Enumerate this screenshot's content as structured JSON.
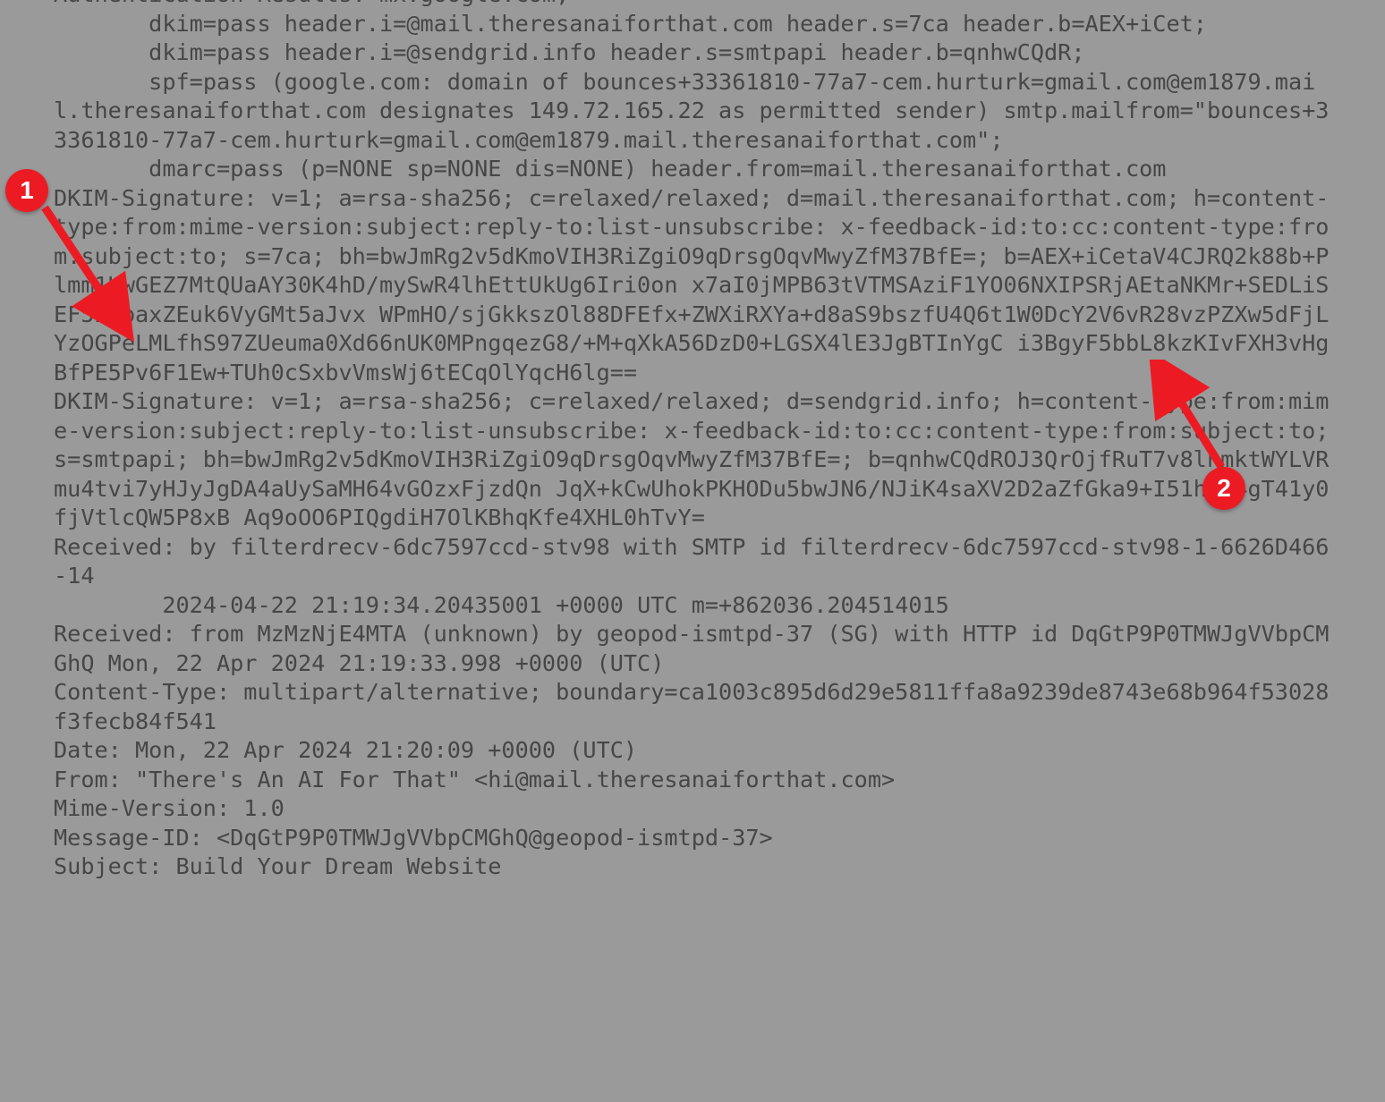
{
  "headers_text": "Authentication-Results: mx.google.com;\n       dkim=pass header.i=@mail.theresanaiforthat.com header.s=7ca header.b=AEX+iCet;\n       dkim=pass header.i=@sendgrid.info header.s=smtpapi header.b=qnhwCQdR;\n       spf=pass (google.com: domain of bounces+33361810-77a7-cem.hurturk=gmail.com@em1879.mail.theresanaiforthat.com designates 149.72.165.22 as permitted sender) smtp.mailfrom=\"bounces+33361810-77a7-cem.hurturk=gmail.com@em1879.mail.theresanaiforthat.com\";\n       dmarc=pass (p=NONE sp=NONE dis=NONE) header.from=mail.theresanaiforthat.com\nDKIM-Signature: v=1; a=rsa-sha256; c=relaxed/relaxed; d=mail.theresanaiforthat.com; h=content-type:from:mime-version:subject:reply-to:list-unsubscribe: x-feedback-id:to:cc:content-type:from:subject:to; s=7ca; bh=bwJmRg2v5dKmoVIH3RiZgiO9qDrsgOqvMwyZfM37BfE=; b=AEX+iCetaV4CJRQ2k88b+Plmm1UwGEZ7MtQUaAY30K4hD/mySwR4lhEttUkUg6Iri0on x7aI0jMPB63tVTMSAziF1YO06NXIPSRjAEtaNKMr+SEDLiSEF5BabaxZEuk6VyGMt5aJvx WPmHO/sjGkkszOl88DFEfx+ZWXiRXYa+d8aS9bszfU4Q6t1W0DcY2V6vR28vzPZXw5dFjL YzOGPeLMLfhS97ZUeuma0Xd66nUK0MPngqezG8/+M+qXkA56DzD0+LGSX4lE3JgBTInYgC i3BgyF5bbL8kzKIvFXH3vHgBfPE5Pv6F1Ew+TUh0cSxbvVmsWj6tECqOlYqcH6lg==\nDKIM-Signature: v=1; a=rsa-sha256; c=relaxed/relaxed; d=sendgrid.info; h=content-type:from:mime-version:subject:reply-to:list-unsubscribe: x-feedback-id:to:cc:content-type:from:subject:to; s=smtpapi; bh=bwJmRg2v5dKmoVIH3RiZgiO9qDrsgOqvMwyZfM37BfE=; b=qnhwCQdROJ3QrOjfRuT7v8lhmktWYLVRmu4tvi7yHJyJgDA4aUySaMH64vGOzxFjzdQn JqX+kCwUhokPKHODu5bwJN6/NJiK4saXV2D2aZfGka9+I51hD/4gT41y0fjVtlcQW5P8xB Aq9oOO6PIQgdiH7OlKBhqKfe4XHL0hTvY=\nReceived: by filterdrecv-6dc7597ccd-stv98 with SMTP id filterdrecv-6dc7597ccd-stv98-1-6626D466-14\n        2024-04-22 21:19:34.20435001 +0000 UTC m=+862036.204514015\nReceived: from MzMzNjE4MTA (unknown) by geopod-ismtpd-37 (SG) with HTTP id DqGtP9P0TMWJgVVbpCMGhQ Mon, 22 Apr 2024 21:19:33.998 +0000 (UTC)\nContent-Type: multipart/alternative; boundary=ca1003c895d6d29e5811ffa8a9239de8743e68b964f53028f3fecb84f541\nDate: Mon, 22 Apr 2024 21:20:09 +0000 (UTC)\nFrom: \"There's An AI For That\" <hi@mail.theresanaiforthat.com>\nMime-Version: 1.0\nMessage-ID: <DqGtP9P0TMWJgVVbpCMGhQ@geopod-ismtpd-37>\nSubject: Build Your Dream Website",
  "annotations": {
    "badge1": "1",
    "badge2": "2"
  },
  "highlight": {
    "note": "DKIM-Signature blocks highlighted in white",
    "key_fields": {
      "d1": "mail.theresanaiforthat.com",
      "s1": "7ca",
      "d2": "sendgrid.info",
      "s2": "smtpapi"
    }
  }
}
